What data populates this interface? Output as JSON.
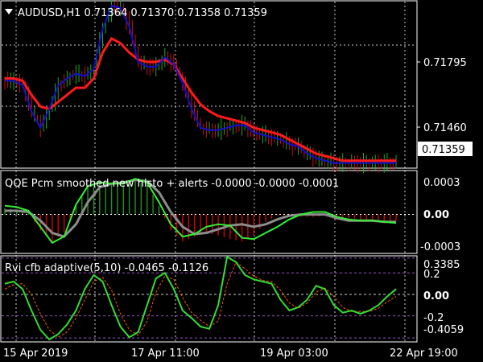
{
  "main": {
    "symbol_line": "AUDUSD,H1  0.71364 0.71370 0.71358 0.71359",
    "price_labels": [
      "0.71795",
      "0.71460"
    ],
    "current_price": "0.71359",
    "grid": true
  },
  "qqe": {
    "title": "QQE Pcm smoothed new histo + alerts -0.0000 -0.0000 -0.0001",
    "scale_labels": [
      "0.0003",
      "0.00",
      "-0.0003"
    ]
  },
  "rvi": {
    "title": "Rvi cfb adaptive(5,10) -0.0465 -0.1126",
    "scale_labels": [
      "0.3385",
      "0.2",
      "0.00",
      "-0.2",
      "-0.4059"
    ]
  },
  "time_labels": [
    "15 Apr 2019",
    "17 Apr 11:00",
    "19 Apr 03:00",
    "22 Apr 19:00"
  ],
  "colors": {
    "background": "#000000",
    "grid": "#ffffff",
    "candle_up": "#22aa22",
    "candle_down": "#cc1111",
    "ma_fast": "#1010d0",
    "ma_slow": "#ff1a1a",
    "qqe_line_green": "#33ee33",
    "qqe_line_gray": "#8c8c8c",
    "histo_up": "#1e8c1e",
    "histo_down": "#cc0000",
    "rvi_main": "#33dd33",
    "rvi_signal": "#ff5500",
    "level_line": "#9a52c9"
  },
  "chart_data": [
    {
      "type": "line",
      "title": "AUDUSD,H1  0.71364 0.71370 0.71358 0.71359",
      "x": [
        0,
        3,
        6,
        9,
        12,
        15,
        18,
        21,
        24,
        27,
        30,
        33,
        36,
        39,
        42,
        45,
        48,
        51,
        54,
        57,
        60,
        63,
        66,
        69,
        72,
        75,
        78,
        81,
        84,
        87,
        90,
        93,
        96,
        99,
        102,
        105,
        108,
        111,
        114,
        117,
        120,
        123,
        126,
        129,
        132
      ],
      "series": [
        {
          "values": [
            0.7171,
            0.7171,
            0.7169,
            0.7158,
            0.7151,
            0.7159,
            0.7169,
            0.7172,
            0.7174,
            0.7173,
            0.7176,
            0.7193,
            0.7203,
            0.7202,
            0.7194,
            0.7179,
            0.7177,
            0.7177,
            0.7181,
            0.7178,
            0.717,
            0.7159,
            0.7151,
            0.715,
            0.715,
            0.7151,
            0.7152,
            0.7152,
            0.7149,
            0.7148,
            0.7147,
            0.7146,
            0.7144,
            0.7143,
            0.714,
            0.7138,
            0.7137,
            0.7136,
            0.7136,
            0.7136,
            0.7136,
            0.7136,
            0.7136,
            0.7136,
            0.7136
          ]
        },
        {
          "values": [
            0.7172,
            0.7172,
            0.7171,
            0.7165,
            0.716,
            0.7159,
            0.7162,
            0.7165,
            0.7168,
            0.7168,
            0.7172,
            0.7183,
            0.7189,
            0.7187,
            0.7183,
            0.718,
            0.7179,
            0.7179,
            0.718,
            0.7178,
            0.7172,
            0.7166,
            0.7161,
            0.7158,
            0.7156,
            0.7155,
            0.7154,
            0.7153,
            0.7151,
            0.715,
            0.7149,
            0.7148,
            0.7146,
            0.7144,
            0.7142,
            0.714,
            0.7139,
            0.7138,
            0.7137,
            0.7137,
            0.7137,
            0.7137,
            0.7137,
            0.7137,
            0.7137
          ]
        }
      ],
      "y_ticks": [
        0.71795,
        0.7146
      ],
      "ylim": [
        0.71338,
        0.72047
      ]
    },
    {
      "type": "bar",
      "title": "QQE Pcm smoothed new histo + alerts -0.0000 -0.0000 -0.0001",
      "x": [
        0,
        4,
        8,
        12,
        16,
        20,
        24,
        28,
        32,
        36,
        40,
        44,
        48,
        52,
        56,
        60,
        64,
        68,
        72,
        76,
        80,
        84,
        88,
        92,
        96,
        100,
        104,
        108,
        112,
        116,
        120,
        124,
        128,
        132
      ],
      "values": [
        5e-05,
        4e-05,
        1e-05,
        -0.00013,
        -0.00022,
        -0.00014,
        8e-05,
        0.00022,
        0.00025,
        0.00024,
        0.00024,
        0.00027,
        0.00025,
        7e-05,
        -0.00013,
        -0.00022,
        -0.00018,
        -0.00015,
        -0.00017,
        -0.0002,
        -0.00022,
        -0.00017,
        -6e-05,
        -1e-05,
        -1e-05,
        -2e-05,
        -2e-05,
        -1e-05,
        -2e-05,
        -3e-05,
        -4e-05,
        -5e-05,
        -6e-05,
        -5e-05
      ],
      "series": [
        {
          "values": [
            7e-05,
            6e-05,
            3e-05,
            -0.0001,
            -0.00023,
            -0.00018,
            8e-05,
            0.00023,
            0.00026,
            0.00025,
            0.00025,
            0.00029,
            0.00026,
            0.0001,
            -8e-05,
            -0.00018,
            -0.00016,
            -0.0001,
            -8e-05,
            -9e-05,
            -0.00019,
            -0.0002,
            -0.00015,
            -0.0001,
            -4e-05,
            0,
            2e-05,
            2e-05,
            -2e-05,
            -4e-05,
            -5e-05,
            -5e-05,
            -6e-05,
            -7e-05
          ]
        },
        {
          "values": [
            3e-05,
            3e-05,
            2e-05,
            -5e-05,
            -0.00015,
            -0.00018,
            -8e-05,
            0.0001,
            0.00022,
            0.00025,
            0.00026,
            0.00028,
            0.00027,
            0.00018,
            2e-05,
            -0.0001,
            -0.00016,
            -0.00015,
            -0.00012,
            -9e-05,
            -8e-05,
            -0.0001,
            -8e-05,
            -4e-05,
            -1e-05,
            0,
            0,
            0,
            -3e-05,
            -5e-05,
            -5e-05,
            -5e-05,
            -6e-05,
            -6e-05
          ]
        }
      ],
      "y_ticks": [
        0.0003,
        0,
        -0.0003
      ],
      "ylim": [
        -0.00031,
        0.00035
      ]
    },
    {
      "type": "line",
      "title": "Rvi cfb adaptive(5,10) -0.0465 -0.1126",
      "x": [
        0,
        3,
        6,
        9,
        12,
        15,
        18,
        21,
        24,
        27,
        30,
        33,
        36,
        39,
        42,
        45,
        48,
        51,
        54,
        57,
        60,
        63,
        66,
        69,
        72,
        75,
        78,
        81,
        84,
        87,
        90,
        93,
        96,
        99,
        102,
        105,
        108,
        111,
        114,
        117,
        120,
        123,
        126,
        129,
        132
      ],
      "series": [
        {
          "values": [
            0.1,
            0.12,
            0.05,
            -0.15,
            -0.33,
            -0.42,
            -0.37,
            -0.28,
            -0.15,
            0.05,
            0.18,
            0.12,
            -0.1,
            -0.3,
            -0.4,
            -0.35,
            -0.1,
            0.15,
            0.2,
            0.05,
            -0.15,
            -0.22,
            -0.3,
            -0.32,
            -0.1,
            0.35,
            0.3,
            0.18,
            0.14,
            0.12,
            0.1,
            -0.05,
            -0.15,
            -0.12,
            -0.05,
            0.08,
            0.05,
            -0.1,
            -0.17,
            -0.15,
            -0.18,
            -0.15,
            -0.1,
            -0.02,
            0.05
          ]
        },
        {
          "values": [
            0.05,
            0.09,
            0.1,
            0.0,
            -0.18,
            -0.33,
            -0.4,
            -0.35,
            -0.22,
            -0.05,
            0.12,
            0.16,
            0.04,
            -0.18,
            -0.33,
            -0.38,
            -0.25,
            0.02,
            0.17,
            0.14,
            -0.03,
            -0.17,
            -0.24,
            -0.3,
            -0.25,
            0.1,
            0.3,
            0.24,
            0.17,
            0.13,
            0.12,
            0.04,
            -0.08,
            -0.13,
            -0.08,
            0.02,
            0.06,
            -0.02,
            -0.12,
            -0.16,
            -0.16,
            -0.16,
            -0.13,
            -0.07,
            -0.02
          ]
        }
      ],
      "y_ticks": [
        0.3385,
        0.2,
        0,
        -0.2,
        -0.4059
      ],
      "ylim": [
        -0.435,
        0.352
      ]
    }
  ]
}
